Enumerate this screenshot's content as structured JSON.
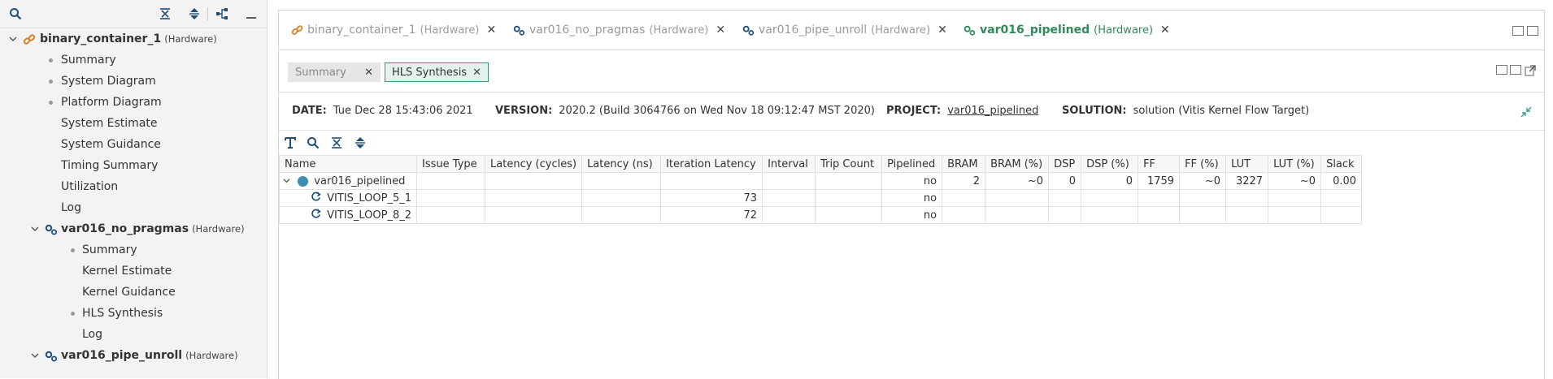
{
  "explorer": {
    "items": [
      {
        "label": "binary_container_1",
        "tag": "(Hardware)"
      },
      {
        "label": "Summary"
      },
      {
        "label": "System Diagram"
      },
      {
        "label": "Platform Diagram"
      },
      {
        "label": "System Estimate"
      },
      {
        "label": "System Guidance"
      },
      {
        "label": "Timing Summary"
      },
      {
        "label": "Utilization"
      },
      {
        "label": "Log"
      },
      {
        "label": "var016_no_pragmas",
        "tag": "(Hardware)"
      },
      {
        "label": "Summary"
      },
      {
        "label": "Kernel Estimate"
      },
      {
        "label": "Kernel Guidance"
      },
      {
        "label": "HLS Synthesis"
      },
      {
        "label": "Log"
      },
      {
        "label": "var016_pipe_unroll",
        "tag": "(Hardware)"
      }
    ]
  },
  "editor_tabs": [
    {
      "name": "binary_container_1",
      "tag": "(Hardware)",
      "icon": "link-icon"
    },
    {
      "name": "var016_no_pragmas",
      "tag": "(Hardware)",
      "icon": "gears-icon"
    },
    {
      "name": "var016_pipe_unroll",
      "tag": "(Hardware)",
      "icon": "gears-icon"
    },
    {
      "name": "var016_pipelined",
      "tag": "(Hardware)",
      "icon": "gears-icon",
      "active": true
    }
  ],
  "report_tabs": [
    {
      "label": "Summary"
    },
    {
      "label": "HLS Synthesis",
      "active": true
    }
  ],
  "info": {
    "date_label": "DATE:",
    "date": "Tue Dec 28 15:43:06 2021",
    "version_label": "VERSION:",
    "version": "2020.2 (Build 3064766 on Wed Nov 18 09:12:47 MST 2020)",
    "project_label": "PROJECT:",
    "project": "var016_pipelined",
    "solution_label": "SOLUTION:",
    "solution": "solution (Vitis Kernel Flow Target)"
  },
  "table": {
    "columns": [
      "Name",
      "Issue Type",
      "Latency (cycles)",
      "Latency (ns)",
      "Iteration Latency",
      "Interval",
      "Trip Count",
      "Pipelined",
      "BRAM",
      "BRAM (%)",
      "DSP",
      "DSP (%)",
      "FF",
      "FF (%)",
      "LUT",
      "LUT (%)",
      "Slack"
    ],
    "rows": [
      {
        "name": "var016_pipelined",
        "cells": [
          "",
          "",
          "",
          "",
          "",
          "",
          "no",
          "2",
          "~0",
          "0",
          "0",
          "1759",
          "~0",
          "3227",
          "~0",
          "0.00"
        ]
      },
      {
        "name": "VITIS_LOOP_5_1",
        "cells": [
          "",
          "",
          "",
          "73",
          "",
          "",
          "no",
          "",
          "",
          "",
          "",
          "",
          "",
          "",
          "",
          ""
        ]
      },
      {
        "name": "VITIS_LOOP_8_2",
        "cells": [
          "",
          "",
          "",
          "72",
          "",
          "",
          "no",
          "",
          "",
          "",
          "",
          "",
          "",
          "",
          "",
          ""
        ]
      }
    ]
  },
  "colors": {
    "accent_green": "#2e8b57",
    "function_dot": "#3f8db3",
    "link_icon": "#d9822b"
  }
}
